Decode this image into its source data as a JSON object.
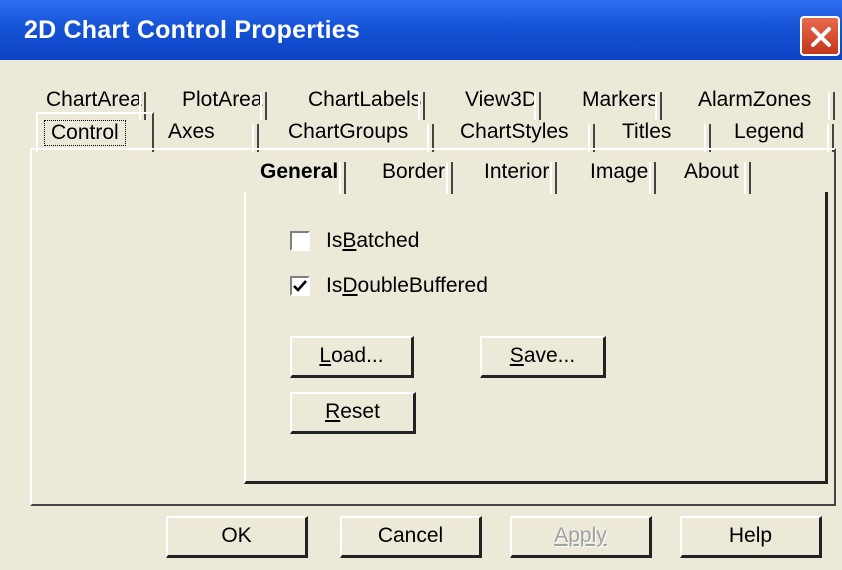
{
  "window": {
    "title": "2D Chart Control Properties"
  },
  "tabs_back": [
    "ChartArea",
    "PlotArea",
    "ChartLabels",
    "View3D",
    "Markers",
    "AlarmZones"
  ],
  "tabs_front": [
    "Control",
    "Axes",
    "ChartGroups",
    "ChartStyles",
    "Titles",
    "Legend"
  ],
  "active_tab": "Control",
  "subtabs": [
    "General",
    "Border",
    "Interior",
    "Image",
    "About"
  ],
  "active_subtab": "General",
  "checkboxes": [
    {
      "label_pre": "Is",
      "label_u": "B",
      "label_post": "atched",
      "checked": false
    },
    {
      "label_pre": "Is",
      "label_u": "D",
      "label_post": "oubleBuffered",
      "checked": true
    }
  ],
  "buttons": {
    "load": {
      "u": "L",
      "rest": "oad..."
    },
    "save": {
      "u": "S",
      "rest": "ave..."
    },
    "reset": {
      "u": "R",
      "rest": "eset"
    }
  },
  "footer": {
    "ok": "OK",
    "cancel": "Cancel",
    "apply": "Apply",
    "help": "Help"
  }
}
